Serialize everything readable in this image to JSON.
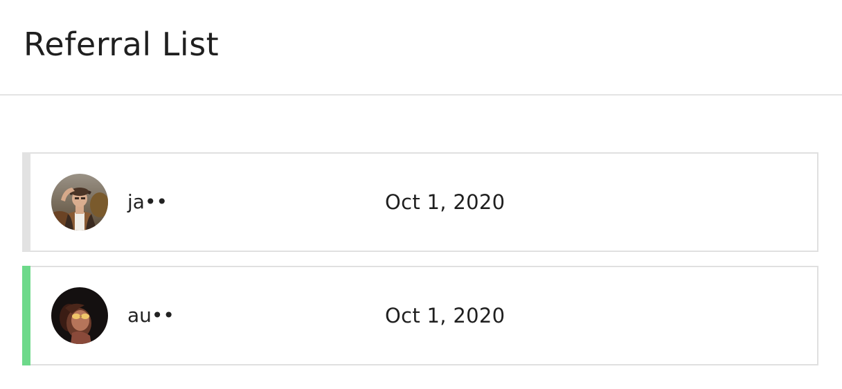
{
  "header": {
    "title": "Referral List"
  },
  "referrals": [
    {
      "name": "ja••",
      "date": "Oct 1, 2020",
      "accent_color": "#e2e2e2",
      "avatar": "avatar-man-hat"
    },
    {
      "name": "au••",
      "date": "Oct 1, 2020",
      "accent_color": "#6dd98a",
      "avatar": "avatar-woman-sunglasses"
    }
  ]
}
